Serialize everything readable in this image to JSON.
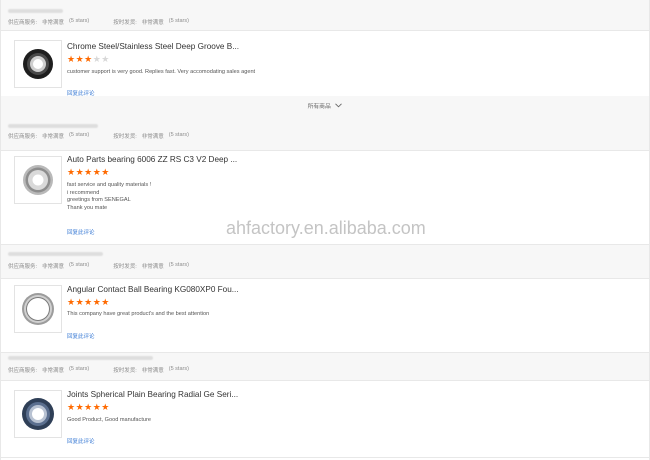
{
  "watermark": "ahfactory.en.alibaba.com",
  "show_all": "所有商品",
  "reviews": [
    {
      "meta": {
        "supplier_service_label": "供应商服务:",
        "supplier_service_value": "非常满意",
        "supplier_stars": "(5 stars)",
        "ontime_label": "按时发货:",
        "ontime_value": "非常满意",
        "ontime_stars": "(5 stars)"
      },
      "product_title": "Chrome Steel/Stainless Steel Deep Groove B...",
      "rating": 3,
      "comment_lines": [
        "customer support is very good. Replies fast. Very accomodating sales agent"
      ],
      "reply_label": "回复此评论"
    },
    {
      "meta": {
        "supplier_service_label": "供应商服务:",
        "supplier_service_value": "非常满意",
        "supplier_stars": "(5 stars)",
        "ontime_label": "按时发货:",
        "ontime_value": "非常满意",
        "ontime_stars": "(5 stars)"
      },
      "product_title": "Auto Parts bearing 6006 ZZ RS C3 V2 Deep ...",
      "rating": 5,
      "comment_lines": [
        "fast service and quality materials !",
        "i recommend",
        "greetings from SENEGAL",
        "Thank you mate"
      ],
      "reply_label": "回复此评论"
    },
    {
      "meta": {
        "supplier_service_label": "供应商服务:",
        "supplier_service_value": "非常满意",
        "supplier_stars": "(5 stars)",
        "ontime_label": "按时发货:",
        "ontime_value": "非常满意",
        "ontime_stars": "(5 stars)"
      },
      "product_title": "Angular Contact Ball Bearing KG080XP0 Fou...",
      "rating": 5,
      "comment_lines": [
        "This company have great product's and the best attention"
      ],
      "reply_label": "回复此评论"
    },
    {
      "meta": {
        "supplier_service_label": "供应商服务:",
        "supplier_service_value": "非常满意",
        "supplier_stars": "(5 stars)",
        "ontime_label": "按时发货:",
        "ontime_value": "非常满意",
        "ontime_stars": "(5 stars)"
      },
      "product_title": "Joints Spherical Plain Bearing Radial Ge Seri...",
      "rating": 5,
      "comment_lines": [
        "Good Product, Good manufacture"
      ],
      "reply_label": "回复此评论"
    }
  ],
  "icons": {
    "chevron": "chevron-down-icon"
  }
}
